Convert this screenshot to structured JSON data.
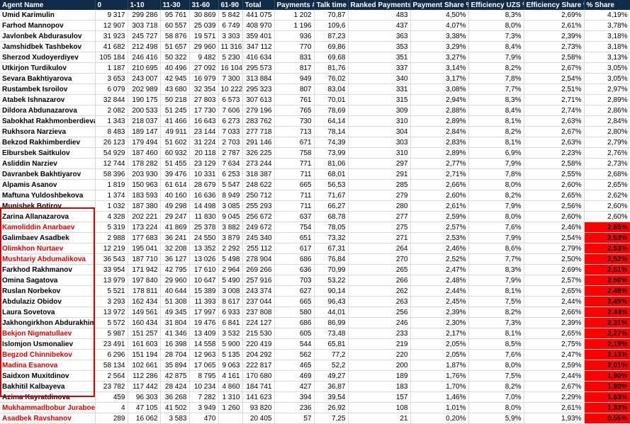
{
  "headers": [
    "Agent Name",
    "0",
    "1-10",
    "11-30",
    "31-60",
    "61-90",
    "Total",
    "Payments #",
    "Talk time",
    "Ranked Payments",
    "Payment Share %",
    "Efficiency UZS %",
    "Efficiency Share %",
    "% Share"
  ],
  "colors": {
    "header_bg": "#0f2b47",
    "header_text": "#ffffff",
    "highlight_red": "#ff0000",
    "name_red": "#e00000",
    "box_border": "#d60000"
  },
  "rows": [
    {
      "name": "Umid Karimulin",
      "c0": "9 317",
      "c1": "299 286",
      "c2": "95 761",
      "c3": "30 869",
      "c4": "5 842",
      "total": "441 075",
      "payments": "1 202",
      "talk": "70,87",
      "ranked": "483",
      "pshare": "4,50%",
      "eff": "8,3%",
      "effshare": "2,69%",
      "share": "4,19%",
      "red": false,
      "hl": false
    },
    {
      "name": "Farhod Mannopov",
      "c0": "12 907",
      "c1": "303 718",
      "c2": "60 557",
      "c3": "25 039",
      "c4": "6 749",
      "total": "408 970",
      "payments": "1 196",
      "talk": "109,6",
      "ranked": "437",
      "pshare": "4,07%",
      "eff": "8,0%",
      "effshare": "2,61%",
      "share": "3,78%",
      "red": false,
      "hl": false
    },
    {
      "name": "Javlonbek Abdurasulov",
      "c0": "31 923",
      "c1": "245 727",
      "c2": "58 876",
      "c3": "19 571",
      "c4": "3 303",
      "total": "359 401",
      "payments": "936",
      "talk": "87,23",
      "ranked": "363",
      "pshare": "3,38%",
      "eff": "7,3%",
      "effshare": "2,39%",
      "share": "3,18%",
      "red": false,
      "hl": false
    },
    {
      "name": "Jamshidbek Tashbekov",
      "c0": "41 682",
      "c1": "212 498",
      "c2": "51 657",
      "c3": "29 960",
      "c4": "11 316",
      "total": "347 112",
      "payments": "770",
      "talk": "69,86",
      "ranked": "353",
      "pshare": "3,29%",
      "eff": "8,4%",
      "effshare": "2,73%",
      "share": "3,18%",
      "red": false,
      "hl": false
    },
    {
      "name": "Sherzod Xudoyerdiyev",
      "c0": "105 184",
      "c1": "246 416",
      "c2": "50 322",
      "c3": "9 482",
      "c4": "5 230",
      "total": "416 634",
      "payments": "831",
      "talk": "69,68",
      "ranked": "351",
      "pshare": "3,27%",
      "eff": "7,9%",
      "effshare": "2,58%",
      "share": "3,13%",
      "red": false,
      "hl": false
    },
    {
      "name": "Utkirjon Turdikulov",
      "c0": "1 187",
      "c1": "210 695",
      "c2": "40 496",
      "c3": "27 092",
      "c4": "16 104",
      "total": "295 573",
      "payments": "817",
      "talk": "81,76",
      "ranked": "337",
      "pshare": "3,14%",
      "eff": "8,2%",
      "effshare": "2,67%",
      "share": "3,05%",
      "red": false,
      "hl": false
    },
    {
      "name": "Sevara Bakhtiyarova",
      "c0": "3 653",
      "c1": "243 007",
      "c2": "42 945",
      "c3": "16 979",
      "c4": "7 300",
      "total": "313 884",
      "payments": "949",
      "talk": "76,02",
      "ranked": "340",
      "pshare": "3,17%",
      "eff": "7,8%",
      "effshare": "2,54%",
      "share": "3,05%",
      "red": false,
      "hl": false
    },
    {
      "name": "Rustambek Isroilov",
      "c0": "6 079",
      "c1": "202 989",
      "c2": "43 680",
      "c3": "32 354",
      "c4": "10 222",
      "total": "295 323",
      "payments": "807",
      "talk": "83,04",
      "ranked": "331",
      "pshare": "3,08%",
      "eff": "7,7%",
      "effshare": "2,51%",
      "share": "2,97%",
      "red": false,
      "hl": false
    },
    {
      "name": "Atabek Ishnazarov",
      "c0": "32 844",
      "c1": "190 175",
      "c2": "50 218",
      "c3": "27 803",
      "c4": "6 573",
      "total": "307 613",
      "payments": "761",
      "talk": "70,01",
      "ranked": "315",
      "pshare": "2,94%",
      "eff": "8,3%",
      "effshare": "2,71%",
      "share": "2,89%",
      "red": false,
      "hl": false
    },
    {
      "name": "Dildora Abdunazarova",
      "c0": "2 082",
      "c1": "200 533",
      "c2": "51 245",
      "c3": "17 730",
      "c4": "7 606",
      "total": "279 196",
      "payments": "765",
      "talk": "78,69",
      "ranked": "309",
      "pshare": "2,88%",
      "eff": "8,4%",
      "effshare": "2,74%",
      "share": "2,86%",
      "red": false,
      "hl": false
    },
    {
      "name": "Sabokhat Rakhmonberdieva",
      "c0": "1 343",
      "c1": "218 037",
      "c2": "41 466",
      "c3": "16 643",
      "c4": "6 273",
      "total": "283 762",
      "payments": "730",
      "talk": "64,14",
      "ranked": "310",
      "pshare": "2,89%",
      "eff": "8,1%",
      "effshare": "2,63%",
      "share": "2,84%",
      "red": false,
      "hl": false
    },
    {
      "name": "Rukhsora Narzieva",
      "c0": "8 483",
      "c1": "189 147",
      "c2": "49 911",
      "c3": "23 144",
      "c4": "7 033",
      "total": "277 718",
      "payments": "713",
      "talk": "78,14",
      "ranked": "304",
      "pshare": "2,84%",
      "eff": "8,2%",
      "effshare": "2,67%",
      "share": "2,80%",
      "red": false,
      "hl": false
    },
    {
      "name": "Bekzod Rakhimberdiev",
      "c0": "26 123",
      "c1": "179 494",
      "c2": "51 602",
      "c3": "31 224",
      "c4": "2 703",
      "total": "291 146",
      "payments": "671",
      "talk": "74,39",
      "ranked": "303",
      "pshare": "2,83%",
      "eff": "8,1%",
      "effshare": "2,63%",
      "share": "2,79%",
      "red": false,
      "hl": false
    },
    {
      "name": "Elbursbek Saitkulov",
      "c0": "54 929",
      "c1": "187 460",
      "c2": "60 932",
      "c3": "20 118",
      "c4": "2 787",
      "total": "326 225",
      "payments": "758",
      "talk": "73,99",
      "ranked": "310",
      "pshare": "2,89%",
      "eff": "6,9%",
      "effshare": "2,23%",
      "share": "2,76%",
      "red": false,
      "hl": false
    },
    {
      "name": "Asliddin Narziev",
      "c0": "12 744",
      "c1": "178 282",
      "c2": "51 455",
      "c3": "23 129",
      "c4": "7 634",
      "total": "273 244",
      "payments": "771",
      "talk": "81,06",
      "ranked": "297",
      "pshare": "2,77%",
      "eff": "7,9%",
      "effshare": "2,58%",
      "share": "2,73%",
      "red": false,
      "hl": false
    },
    {
      "name": "Davranbek Bakhtiyarov",
      "c0": "58 396",
      "c1": "203 930",
      "c2": "39 476",
      "c3": "10 331",
      "c4": "6 253",
      "total": "318 387",
      "payments": "711",
      "talk": "68,01",
      "ranked": "291",
      "pshare": "2,71%",
      "eff": "7,8%",
      "effshare": "2,55%",
      "share": "2,68%",
      "red": false,
      "hl": false
    },
    {
      "name": "Alpamis Asanov",
      "c0": "1 819",
      "c1": "150 963",
      "c2": "61 614",
      "c3": "28 679",
      "c4": "5 547",
      "total": "248 622",
      "payments": "665",
      "talk": "56,53",
      "ranked": "285",
      "pshare": "2,66%",
      "eff": "8,0%",
      "effshare": "2,60%",
      "share": "2,65%",
      "red": false,
      "hl": false
    },
    {
      "name": "Maftuna Yuldoshbekova",
      "c0": "1 374",
      "c1": "183 593",
      "c2": "40 160",
      "c3": "16 636",
      "c4": "8 949",
      "total": "250 712",
      "payments": "711",
      "talk": "71,67",
      "ranked": "279",
      "pshare": "2,60%",
      "eff": "8,2%",
      "effshare": "2,65%",
      "share": "2,62%",
      "red": false,
      "hl": false
    },
    {
      "name": "Munisbek Botirov",
      "c0": "1 032",
      "c1": "187 380",
      "c2": "49 298",
      "c3": "14 498",
      "c4": "3 085",
      "total": "255 293",
      "payments": "711",
      "talk": "66,27",
      "ranked": "280",
      "pshare": "2,61%",
      "eff": "7,9%",
      "effshare": "2,56%",
      "share": "2,60%",
      "red": false,
      "hl": false
    },
    {
      "name": "Zarina Allanazarova",
      "c0": "4 328",
      "c1": "202 221",
      "c2": "29 247",
      "c3": "11 830",
      "c4": "9 045",
      "total": "256 672",
      "payments": "637",
      "talk": "68,78",
      "ranked": "277",
      "pshare": "2,59%",
      "eff": "8,0%",
      "effshare": "2,60%",
      "share": "2,60%",
      "red": false,
      "hl": false
    },
    {
      "name": "Kamoliddin Anarbaev",
      "c0": "5 319",
      "c1": "173 224",
      "c2": "41 869",
      "c3": "25 378",
      "c4": "3 882",
      "total": "249 672",
      "payments": "754",
      "talk": "78,05",
      "ranked": "275",
      "pshare": "2,57%",
      "eff": "7,6%",
      "effshare": "2,46%",
      "share": "2,55%",
      "red": true,
      "hl": true
    },
    {
      "name": "Galimbaev Asadbek",
      "c0": "2 988",
      "c1": "177 683",
      "c2": "36 241",
      "c3": "24 550",
      "c4": "3 879",
      "total": "245 340",
      "payments": "651",
      "talk": "73,32",
      "ranked": "271",
      "pshare": "2,53%",
      "eff": "7,9%",
      "effshare": "2,54%",
      "share": "2,53%",
      "red": false,
      "hl": true
    },
    {
      "name": "Olimkhon Nurtaev",
      "c0": "12 219",
      "c1": "195 041",
      "c2": "32 208",
      "c3": "13 352",
      "c4": "2 292",
      "total": "255 112",
      "payments": "617",
      "talk": "67,31",
      "ranked": "264",
      "pshare": "2,46%",
      "eff": "8,6%",
      "effshare": "2,79%",
      "share": "2,53%",
      "red": true,
      "hl": true
    },
    {
      "name": "Mushtariy Abdumalikova",
      "c0": "36 543",
      "c1": "187 710",
      "c2": "36 127",
      "c3": "13 026",
      "c4": "5 498",
      "total": "278 904",
      "payments": "686",
      "talk": "76,84",
      "ranked": "270",
      "pshare": "2,52%",
      "eff": "7,7%",
      "effshare": "2,50%",
      "share": "2,52%",
      "red": true,
      "hl": true
    },
    {
      "name": "Farkhod Rakhmanov",
      "c0": "33 954",
      "c1": "171 942",
      "c2": "42 795",
      "c3": "17 610",
      "c4": "2 964",
      "total": "269 266",
      "payments": "636",
      "talk": "70,99",
      "ranked": "265",
      "pshare": "2,47%",
      "eff": "8,3%",
      "effshare": "2,69%",
      "share": "2,51%",
      "red": false,
      "hl": true
    },
    {
      "name": "Omina Sagatova",
      "c0": "13 979",
      "c1": "197 840",
      "c2": "29 960",
      "c3": "10 647",
      "c4": "5 490",
      "total": "257 916",
      "payments": "703",
      "talk": "53,22",
      "ranked": "266",
      "pshare": "2,48%",
      "eff": "7,9%",
      "effshare": "2,57%",
      "share": "2,50%",
      "red": false,
      "hl": true
    },
    {
      "name": "Ruslan Norbekov",
      "c0": "5 521",
      "c1": "178 811",
      "c2": "40 644",
      "c3": "15 389",
      "c4": "3 008",
      "total": "243 374",
      "payments": "627",
      "talk": "90,14",
      "ranked": "262",
      "pshare": "2,44%",
      "eff": "8,1%",
      "effshare": "2,65%",
      "share": "2,48%",
      "red": false,
      "hl": true
    },
    {
      "name": "Abdulaziz Obidov",
      "c0": "3 293",
      "c1": "162 434",
      "c2": "51 308",
      "c3": "11 393",
      "c4": "8 617",
      "total": "237 044",
      "payments": "665",
      "talk": "96,43",
      "ranked": "263",
      "pshare": "2,45%",
      "eff": "7,5%",
      "effshare": "2,44%",
      "share": "2,45%",
      "red": false,
      "hl": true
    },
    {
      "name": "Laura Sovetova",
      "c0": "13 972",
      "c1": "149 561",
      "c2": "49 345",
      "c3": "17 997",
      "c4": "6 933",
      "total": "237 808",
      "payments": "580",
      "talk": "44,01",
      "ranked": "256",
      "pshare": "2,39%",
      "eff": "8,2%",
      "effshare": "2,66%",
      "share": "2,44%",
      "red": false,
      "hl": true
    },
    {
      "name": "Jakhongirkhon Abdurakhimo",
      "c0": "5 572",
      "c1": "160 434",
      "c2": "31 804",
      "c3": "19 476",
      "c4": "6 841",
      "total": "224 127",
      "payments": "686",
      "talk": "86,99",
      "ranked": "246",
      "pshare": "2,30%",
      "eff": "7,3%",
      "effshare": "2,39%",
      "share": "2,31%",
      "red": false,
      "hl": true
    },
    {
      "name": "Bekjon Nigmatullaev",
      "c0": "5 987",
      "c1": "151 257",
      "c2": "41 346",
      "c3": "13 409",
      "c4": "3 532",
      "total": "215 530",
      "payments": "605",
      "talk": "73,48",
      "ranked": "233",
      "pshare": "2,17%",
      "eff": "8,1%",
      "effshare": "2,65%",
      "share": "2,27%",
      "red": true,
      "hl": true
    },
    {
      "name": "Islomjon Usmonaliev",
      "c0": "23 491",
      "c1": "161 603",
      "c2": "16 398",
      "c3": "14 558",
      "c4": "5 900",
      "total": "220 419",
      "payments": "544",
      "talk": "65,81",
      "ranked": "219",
      "pshare": "2,05%",
      "eff": "8,5%",
      "effshare": "2,75%",
      "share": "2,19%",
      "red": false,
      "hl": true
    },
    {
      "name": "Begzod Chinnibekov",
      "c0": "6 296",
      "c1": "151 194",
      "c2": "28 704",
      "c3": "12 963",
      "c4": "5 135",
      "total": "204 292",
      "payments": "562",
      "talk": "77,2",
      "ranked": "220",
      "pshare": "2,05%",
      "eff": "7,6%",
      "effshare": "2,47%",
      "share": "2,13%",
      "red": true,
      "hl": true
    },
    {
      "name": "Madina Esanova",
      "c0": "58 134",
      "c1": "102 661",
      "c2": "35 894",
      "c3": "17 065",
      "c4": "9 063",
      "total": "222 817",
      "payments": "465",
      "talk": "52,2",
      "ranked": "200",
      "pshare": "1,87%",
      "eff": "8,0%",
      "effshare": "2,59%",
      "share": "2,01%",
      "red": true,
      "hl": true
    },
    {
      "name": "Saidxon Muxitdinov",
      "c0": "2 564",
      "c1": "112 286",
      "c2": "42 875",
      "c3": "8 795",
      "c4": "4 161",
      "total": "170 680",
      "payments": "469",
      "talk": "49,27",
      "ranked": "189",
      "pshare": "1,76%",
      "eff": "7,5%",
      "effshare": "2,44%",
      "share": "1,90%",
      "red": false,
      "hl": true
    },
    {
      "name": "Bakhitil Kalbayeva",
      "c0": "23 782",
      "c1": "117 442",
      "c2": "28 424",
      "c3": "10 234",
      "c4": "4 860",
      "total": "184 741",
      "payments": "427",
      "talk": "36,87",
      "ranked": "183",
      "pshare": "1,70%",
      "eff": "8,2%",
      "effshare": "2,67%",
      "share": "1,90%",
      "red": false,
      "hl": true
    },
    {
      "name": "Azima Kayratdinova",
      "c0": "459",
      "c1": "96 303",
      "c2": "36 268",
      "c3": "7 282",
      "c4": "1 310",
      "total": "141 623",
      "payments": "394",
      "talk": "39,54",
      "ranked": "157",
      "pshare": "1,46%",
      "eff": "7,0%",
      "effshare": "2,29%",
      "share": "1,63%",
      "red": false,
      "hl": true
    },
    {
      "name": "Mukhammadbobur Juraboev",
      "c0": "4",
      "c1": "47 105",
      "c2": "41 502",
      "c3": "3 949",
      "c4": "1 260",
      "total": "93 820",
      "payments": "236",
      "talk": "26,92",
      "ranked": "108",
      "pshare": "1,01%",
      "eff": "8,0%",
      "effshare": "2,61%",
      "share": "1,33%",
      "red": true,
      "hl": true
    },
    {
      "name": "Asadbek Ravshanov",
      "c0": "289",
      "c1": "16 062",
      "c2": "3 583",
      "c3": "470",
      "c4": "",
      "total": "20 405",
      "payments": "57",
      "talk": "7,25",
      "ranked": "21",
      "pshare": "0,20%",
      "eff": "5,9%",
      "effshare": "1,93%",
      "share": "0,55%",
      "red": true,
      "hl": true
    }
  ]
}
